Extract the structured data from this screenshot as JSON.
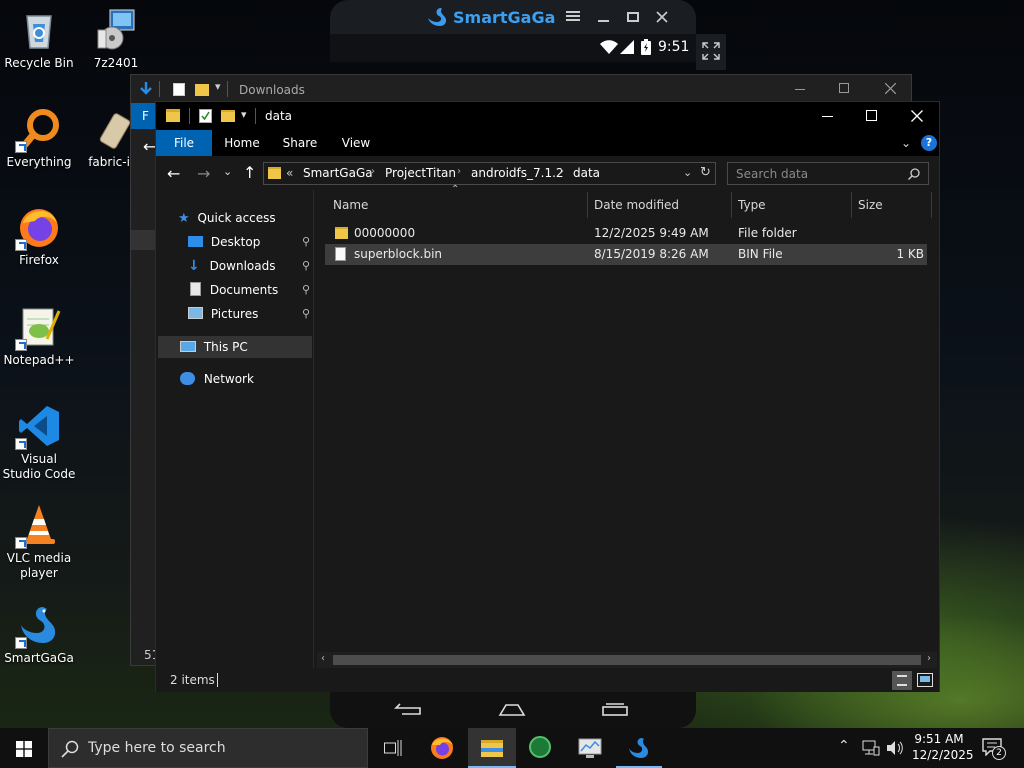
{
  "desktop": {
    "icons": [
      {
        "label": "Recycle Bin"
      },
      {
        "label": "7z2401"
      },
      {
        "label": "Everything"
      },
      {
        "label": "fabric-ins"
      },
      {
        "label": "Firefox"
      },
      {
        "label": "Notepad++"
      },
      {
        "label": "Visual Studio Code"
      },
      {
        "label": "VLC media player"
      },
      {
        "label": "SmartGaGa"
      }
    ]
  },
  "emulator": {
    "brand": "SmartGaGa",
    "time": "9:51"
  },
  "back_window": {
    "title": "Downloads",
    "tab_hint": "F",
    "count_hint": "51"
  },
  "window": {
    "title": "data",
    "ribbon_tabs": [
      "File",
      "Home",
      "Share",
      "View"
    ],
    "address": {
      "prefix": "«",
      "segments": [
        "SmartGaGa",
        "ProjectTitan",
        "androidfs_7.1.2",
        "data"
      ]
    },
    "search": {
      "placeholder": "Search data"
    },
    "nav": {
      "quick_access": "Quick access",
      "items": [
        {
          "label": "Desktop",
          "pinned": true
        },
        {
          "label": "Downloads",
          "pinned": true
        },
        {
          "label": "Documents",
          "pinned": true
        },
        {
          "label": "Pictures",
          "pinned": true
        }
      ],
      "this_pc": "This PC",
      "network": "Network"
    },
    "columns": {
      "name": "Name",
      "date": "Date modified",
      "type": "Type",
      "size": "Size"
    },
    "files": [
      {
        "name": "00000000",
        "date": "12/2/2025 9:49 AM",
        "type": "File folder",
        "size": "",
        "kind": "folder"
      },
      {
        "name": "superblock.bin",
        "date": "8/15/2019 8:26 AM",
        "type": "BIN File",
        "size": "1 KB",
        "kind": "file"
      }
    ],
    "status": {
      "count": "2 items"
    }
  },
  "taskbar": {
    "search_placeholder": "Type here to search",
    "clock_time": "9:51 AM",
    "clock_date": "12/2/2025",
    "notification_count": "2"
  },
  "colors": {
    "accent": "#0063b1",
    "selected_row": "#3d3d3d",
    "window_bg": "#191919",
    "folder": "#f0c64a"
  }
}
